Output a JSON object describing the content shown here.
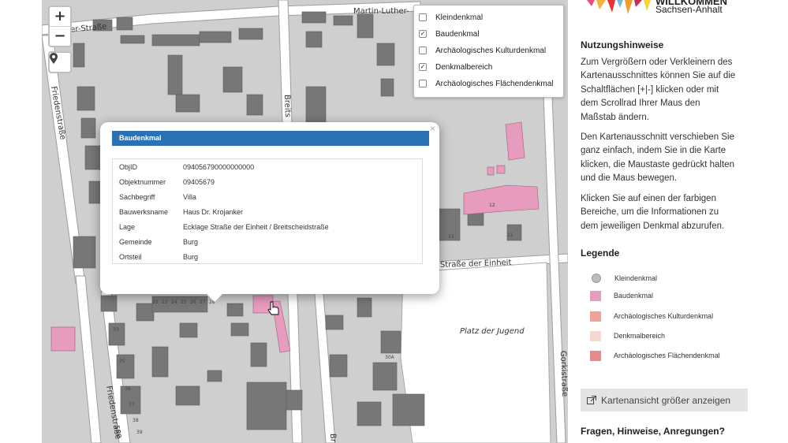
{
  "map": {
    "zoom_in": "+",
    "zoom_out": "−",
    "street_labels": {
      "martin_luther": "Martin-Luther-",
      "luther_left": "uther-Straße",
      "friedenstrasse_top": "Friedenstraße",
      "breits": "Breits",
      "strasse_einheit": "Straße der Einheit",
      "platz_jugend": "Platz der Jugend",
      "gorkistrasse": "Gorkistraße",
      "friedenstrasse_bottom": "Friedenstraße",
      "bro": "Br",
      "se": "sse"
    },
    "house_numbers": [
      "12",
      "11",
      "13",
      "22",
      "23",
      "24",
      "25",
      "26",
      "27",
      "28",
      "30A",
      "33",
      "35",
      "36",
      "37",
      "38",
      "39"
    ]
  },
  "layers": {
    "items": [
      {
        "label": "Kleindenkmal",
        "checked": false
      },
      {
        "label": "Baudenkmal",
        "checked": true
      },
      {
        "label": "Archäologisches Kulturdenkmal",
        "checked": false
      },
      {
        "label": "Denkmalbereich",
        "checked": true
      },
      {
        "label": "Archäologisches Flächendenkmal",
        "checked": false
      }
    ]
  },
  "popup": {
    "close": "×",
    "header": "Baudenkmal",
    "rows": [
      {
        "key": "ObjID",
        "value": "094056790000000000"
      },
      {
        "key": "Objektnummer",
        "value": "09405679"
      },
      {
        "key": "Sachbegriff",
        "value": "Villa"
      },
      {
        "key": "Bauwerksname",
        "value": "Haus Dr. Krojanker"
      },
      {
        "key": "Lage",
        "value": "Ecklage Straße der Einheit / Breitscheidstraße"
      },
      {
        "key": "Gemeinde",
        "value": "Burg"
      },
      {
        "key": "Ortsteil",
        "value": "Burg"
      }
    ]
  },
  "sidebar": {
    "logo_title": "WILLKOMMEN",
    "logo_subtitle": "Sachsen-Anhalt",
    "usage_heading": "Nutzungshinweise",
    "para1_lines": [
      "Zum Vergrößern oder Verkleinern des",
      "Kartenausschnittes können Sie auf die",
      "Schaltflächen [+|-] klicken oder mit",
      "dem Scrollrad Ihrer Maus den",
      "Maßstab ändern."
    ],
    "para2_lines": [
      "Den Kartenausschnitt verschieben Sie",
      "ganz einfach, indem Sie in die Karte",
      "klicken, die Maustaste gedrückt halten",
      "und die Maus bewegen."
    ],
    "para3_lines": [
      "Klicken Sie auf einen der farbigen",
      "Bereiche, um die Informationen zu",
      "dem jeweiligen Denkmal abzurufen."
    ],
    "legend_heading": "Legende",
    "legend": [
      {
        "label": "Kleindenkmal",
        "color": "#bdbdbd"
      },
      {
        "label": "Baudenkmal",
        "color": "#e79bbd"
      },
      {
        "label": "Archäologisches Kulturdenkmal",
        "color": "#f1a39a"
      },
      {
        "label": "Denkmalbereich",
        "color": "#f5d8cf"
      },
      {
        "label": "Archäologisches Flächendenkmal",
        "color": "#e58a8a"
      }
    ],
    "bigmap_button": "Kartenansicht größer anzeigen",
    "questions_heading": "Fragen, Hinweise, Anregungen?"
  }
}
